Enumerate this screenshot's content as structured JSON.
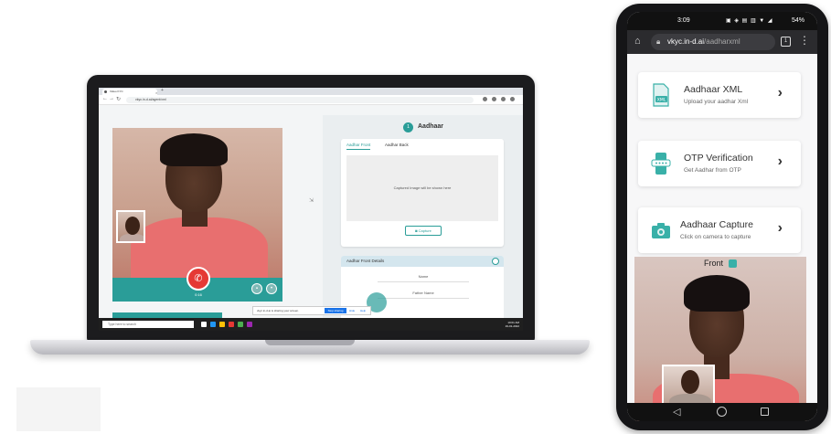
{
  "browser": {
    "tab_title": "Video KYC",
    "url": "vkyc.in-d.ai/agent/xml"
  },
  "call": {
    "timer": "0:16"
  },
  "agent_panel": {
    "step_number": "1",
    "step_title": "Aadhaar",
    "tabs": [
      "Aadhar Front",
      "Aadhar Back"
    ],
    "capture_placeholder": "Captured Image will be shown here",
    "capture_button": "Capture",
    "details_title": "Aadhar Front Details",
    "fields": [
      "Name",
      "Father Name"
    ]
  },
  "screen_share": {
    "message": "vkyc.in-d.ai is sharing your screen.",
    "stop_label": "Stop sharing",
    "hide_label": "Hide",
    "help_label": "Help"
  },
  "taskbar": {
    "search_placeholder": "Type here to search",
    "time": "10:01 AM",
    "date": "19-01-2022"
  },
  "phone": {
    "status": {
      "time": "3:09",
      "battery": "54%"
    },
    "url_domain": "vkyc.in-d.ai",
    "url_path": "/aadharxml",
    "tabs_count": "1",
    "options": [
      {
        "title": "Aadhaar XML",
        "subtitle": "Upload your aadhar Xml",
        "icon": "xml-file-icon"
      },
      {
        "title": "OTP Verification",
        "subtitle": "Get Aadhar from OTP",
        "icon": "otp-phone-icon"
      },
      {
        "title": "Aadhaar Capture",
        "subtitle": "Click on camera to capture",
        "icon": "camera-icon"
      }
    ],
    "front_label": "Front"
  },
  "colors": {
    "teal": "#2a9d98",
    "end_call": "#e53935",
    "share_blue": "#1a73e8"
  }
}
